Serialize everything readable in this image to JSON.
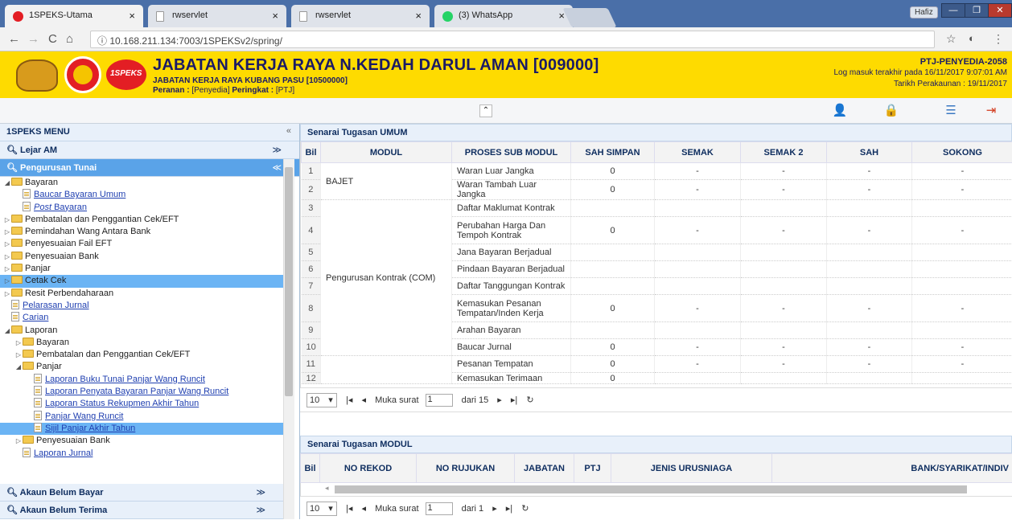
{
  "browser": {
    "tabs": [
      {
        "label": "1SPEKS-Utama"
      },
      {
        "label": "rwservlet"
      },
      {
        "label": "rwservlet"
      },
      {
        "label": "(3) WhatsApp"
      }
    ],
    "user_chip": "Hafiz",
    "url": "ⓘ 10.168.211.134:7003/1SPEKSv2/spring/"
  },
  "header": {
    "logo_text": "1SPEKS",
    "title": "JABATAN KERJA RAYA N.KEDAH DARUL AMAN [009000]",
    "subtitle": "JABATAN KERJA RAYA KUBANG PASU [10500000]",
    "role_label": "Peranan :",
    "role_value": " [Penyedia] ",
    "level_label": "Peringkat :",
    "level_value": " [PTJ]",
    "ptj": "PTJ-PENYEDIA-2058",
    "last_login": "Log masuk terakhir pada 16/11/2017 9:07:01 AM",
    "account_date": "Tarikh Perakaunan : 19/11/2017"
  },
  "sidebar": {
    "title": "1SPEKS MENU",
    "lejar": "Lejar AM",
    "pengurusan": "Pengurusan Tunai",
    "tree": [
      {
        "level": 0,
        "type": "folder",
        "open": true,
        "label": "Bayaran"
      },
      {
        "level": 1,
        "type": "doc",
        "label": "Baucar Bayaran Umum"
      },
      {
        "level": 1,
        "type": "doc",
        "italic": true,
        "label": "Post",
        "label2": " Bayaran"
      },
      {
        "level": 0,
        "type": "folder",
        "label": "Pembatalan dan Penggantian Cek/EFT"
      },
      {
        "level": 0,
        "type": "folder",
        "label": "Pemindahan Wang Antara Bank"
      },
      {
        "level": 0,
        "type": "folder",
        "label": "Penyesuaian Fail EFT"
      },
      {
        "level": 0,
        "type": "folder",
        "label": "Penyesuaian Bank"
      },
      {
        "level": 0,
        "type": "folder",
        "label": "Panjar"
      },
      {
        "level": 0,
        "type": "folder",
        "label": "Cetak Cek",
        "selected": true
      },
      {
        "level": 0,
        "type": "folder",
        "label": "Resit Perbendaharaan"
      },
      {
        "level": 0,
        "type": "doc",
        "label": "Pelarasan Jurnal"
      },
      {
        "level": 0,
        "type": "doc",
        "label": "Carian"
      },
      {
        "level": 0,
        "type": "folder",
        "open": true,
        "label": "Laporan"
      },
      {
        "level": 1,
        "type": "folder",
        "label": "Bayaran"
      },
      {
        "level": 1,
        "type": "folder",
        "label": "Pembatalan dan Penggantian Cek/EFT"
      },
      {
        "level": 1,
        "type": "folder",
        "open": true,
        "label": "Panjar"
      },
      {
        "level": 2,
        "type": "doc",
        "label": "Laporan Buku Tunai Panjar Wang Runcit"
      },
      {
        "level": 2,
        "type": "doc",
        "label": "Laporan Penyata Bayaran Panjar Wang Runcit"
      },
      {
        "level": 2,
        "type": "doc",
        "label": "Laporan Status Rekupmen Akhir Tahun"
      },
      {
        "level": 2,
        "type": "doc",
        "label": "Panjar Wang Runcit"
      },
      {
        "level": 2,
        "type": "doc",
        "label": "Sijil Panjar Akhir Tahun",
        "selected": true
      },
      {
        "level": 1,
        "type": "folder",
        "label": "Penyesuaian Bank"
      },
      {
        "level": 1,
        "type": "doc",
        "label": "Laporan Jurnal"
      }
    ],
    "bottom": [
      {
        "label": "Akaun Belum Bayar"
      },
      {
        "label": "Akaun Belum Terima"
      }
    ]
  },
  "umum": {
    "title": "Senarai Tugasan UMUM",
    "columns": [
      "Bil",
      "MODUL",
      "PROSES SUB MODUL",
      "SAH SIMPAN",
      "SEMAK",
      "SEMAK 2",
      "SAH",
      "SOKONG"
    ],
    "rows": [
      {
        "bil": "1",
        "proses": "Waran Luar Jangka",
        "simpan": "0",
        "semak": "-",
        "semak2": "-",
        "sah": "-",
        "sokong": "-"
      },
      {
        "bil": "2",
        "proses": "Waran Tambah Luar Jangka",
        "simpan": "0",
        "semak": "-",
        "semak2": "-",
        "sah": "-",
        "sokong": "-"
      },
      {
        "bil": "3",
        "proses": "Daftar Maklumat Kontrak",
        "simpan": "",
        "semak": "",
        "semak2": "",
        "sah": "",
        "sokong": ""
      },
      {
        "bil": "4",
        "proses": "Perubahan Harga Dan Tempoh Kontrak",
        "simpan": "0",
        "semak": "-",
        "semak2": "-",
        "sah": "-",
        "sokong": "-"
      },
      {
        "bil": "5",
        "proses": "Jana Bayaran Berjadual",
        "simpan": "",
        "semak": "",
        "semak2": "",
        "sah": "",
        "sokong": ""
      },
      {
        "bil": "6",
        "proses": "Pindaan Bayaran Berjadual",
        "simpan": "",
        "semak": "",
        "semak2": "",
        "sah": "",
        "sokong": ""
      },
      {
        "bil": "7",
        "proses": "Daftar Tanggungan Kontrak",
        "simpan": "",
        "semak": "",
        "semak2": "",
        "sah": "",
        "sokong": ""
      },
      {
        "bil": "8",
        "proses": "Kemasukan Pesanan Tempatan/Inden Kerja",
        "simpan": "0",
        "semak": "-",
        "semak2": "-",
        "sah": "-",
        "sokong": "-"
      },
      {
        "bil": "9",
        "proses": "Arahan Bayaran",
        "simpan": "",
        "semak": "",
        "semak2": "",
        "sah": "",
        "sokong": ""
      },
      {
        "bil": "10",
        "proses": "Baucar Jurnal",
        "simpan": "0",
        "semak": "-",
        "semak2": "-",
        "sah": "-",
        "sokong": "-"
      },
      {
        "bil": "11",
        "proses": "Pesanan Tempatan",
        "simpan": "0",
        "semak": "-",
        "semak2": "-",
        "sah": "-",
        "sokong": "-"
      },
      {
        "bil": "12",
        "proses": "Kemasukan Terimaan",
        "simpan": "0",
        "semak": "",
        "semak2": "",
        "sah": "",
        "sokong": ""
      }
    ],
    "modul_bajet": "BAJET",
    "modul_kontrak": "Pengurusan Kontrak (COM)",
    "pager": {
      "size": "10",
      "muka": "Muka surat",
      "page": "1",
      "dari": "dari 15"
    }
  },
  "modul": {
    "title": "Senarai Tugasan MODUL",
    "columns": [
      "Bil",
      "NO REKOD",
      "NO RUJUKAN",
      "JABATAN",
      "PTJ",
      "JENIS URUSNIAGA",
      "BANK/SYARIKAT/INDIV"
    ],
    "pager": {
      "size": "10",
      "muka": "Muka surat",
      "page": "1",
      "dari": "dari 1"
    }
  }
}
